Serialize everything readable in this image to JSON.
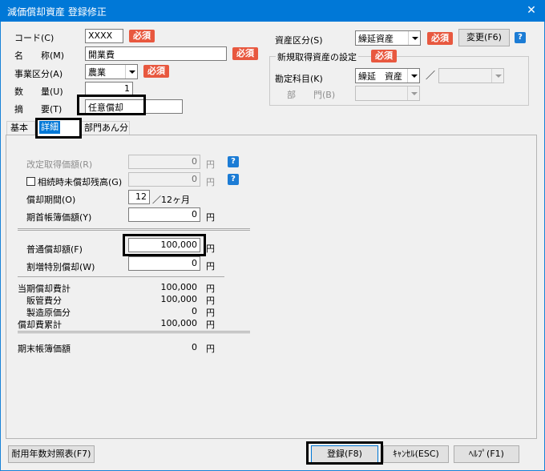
{
  "window": {
    "title": "減価償却資産 登録修正",
    "close": "✕"
  },
  "header": {
    "code_label": "コード(C)",
    "code_value": "XXXX",
    "name_label": "名　　称(M)",
    "name_value": "開業費",
    "business_label": "事業区分(A)",
    "business_value": "農業",
    "qty_label": "数　　量(U)",
    "qty_value": "1",
    "summary_label": "摘　　要(T)",
    "summary_value": "任意償却",
    "required": "必須",
    "asset_class_label": "資産区分(S)",
    "asset_class_value": "繰延資産",
    "change_button": "変更(F6)",
    "new_asset_group": "新規取得資産の設定",
    "account_label": "勘定科目(K)",
    "account_value": "繰延　資産",
    "dept_label": "部　　門(B)",
    "slash": "／"
  },
  "tabs": [
    {
      "label": "基本"
    },
    {
      "label": "詳細"
    },
    {
      "label": "部門あん分"
    }
  ],
  "detail": {
    "revised_cost_label": "改定取得価額(R)",
    "revised_cost_value": "0",
    "inherit_label": "相続時未償却残高(G)",
    "inherit_value": "0",
    "period_label": "償却期間(O)",
    "period_value": "12",
    "period_unit": "／12ヶ月",
    "opening_label": "期首帳簿価額(Y)",
    "opening_value": "0",
    "normal_label": "普通償却額(F)",
    "normal_value": "100,000",
    "special_label": "割増特別償却(W)",
    "special_value": "0",
    "current_total_label": "当期償却費計",
    "current_total_value": "100,000",
    "sales_label": "販管費分",
    "sales_value": "100,000",
    "mfg_label": "製造原価分",
    "mfg_value": "0",
    "accum_label": "償却費累計",
    "accum_value": "100,000",
    "closing_label": "期末帳簿価額",
    "closing_value": "0",
    "yen": "円",
    "help": "?"
  },
  "footer": {
    "life_table_button": "耐用年数対照表(F7)",
    "register_button": "登録(F8)",
    "cancel_button": "ｷｬﾝｾﾙ(ESC)",
    "help_button": "ﾍﾙﾌﾟ(F1)"
  }
}
